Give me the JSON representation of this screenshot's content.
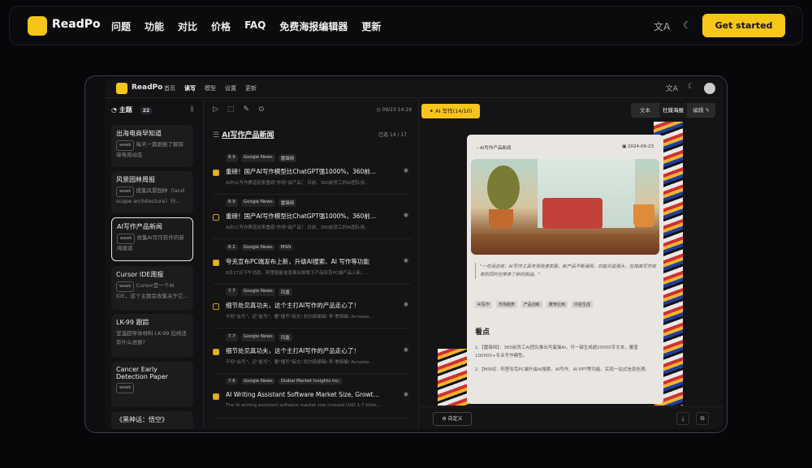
{
  "nav": {
    "brand": "ReadPo",
    "items": [
      "问题",
      "功能",
      "对比",
      "价格",
      "FAQ",
      "免费海报编辑器",
      "更新"
    ],
    "translate_icon": "文A",
    "theme_icon": "☾",
    "cta": "Get started"
  },
  "app": {
    "brand": "ReadPo",
    "nav": [
      "首页",
      "读写",
      "模型",
      "设置",
      "更新"
    ],
    "icons": [
      "文A",
      "☾"
    ],
    "sidebar": {
      "title": "主题",
      "count": "22",
      "topics": [
        {
          "title": "出海电商早知道",
          "badge": "week",
          "desc": "每天一篇跟报了解跨境电商动态"
        },
        {
          "title": "风景园林周报",
          "badge": "week",
          "desc": "搜集风景园林（land scape architecture）行..."
        },
        {
          "title": "AI写作产品新闻",
          "badge": "week",
          "desc": "收集AI写作软件的新闻报道"
        },
        {
          "title": "Cursor IDE周报",
          "badge": "week",
          "desc": "Cursor是一个AI IDE，这个主题会收集关于它..."
        },
        {
          "title": "LK-99 跟踪",
          "badge": "",
          "desc": "室温超导体材料 LK-99 后续还有什么进展?"
        },
        {
          "title": "Cancer Early Detection Paper",
          "badge": "week",
          "desc": ""
        },
        {
          "title": "《黑神话：悟空》",
          "badge": "",
          "desc": ""
        }
      ]
    },
    "middle": {
      "tools": [
        "▷",
        "⬚",
        "✎",
        "⊙"
      ],
      "time": "◷ 09/23 14:19",
      "title": "AI写作产品新闻",
      "selected": "已选 14 / 17",
      "list_icon": "☰",
      "items": [
        {
          "score": "8.9",
          "tags": [
            "Google News",
            "雷锋网"
          ],
          "title": "重磅！国产AI写作模型比ChatGPT强1000%，360前...",
          "summary": "AI办公写作赛道迎来重磅\"炸场\"级产品！ 日前，360前员工的AI团队用...",
          "checked": true
        },
        {
          "score": "8.9",
          "tags": [
            "Google News",
            "雷锋网"
          ],
          "title": "重磅！国产AI写作模型比ChatGPT强1000%，360前...",
          "summary": "AI办公写作赛道迎来重磅\"炸场\"级产品！ 日前，360前员工的AI团队用...",
          "checked": false
        },
        {
          "score": "8.2",
          "tags": [
            "Google News",
            "MSN"
          ],
          "title": "夸克宣布PC端发布上新，升级AI搜索、AI 写作等功能",
          "summary": "8月27日下午消息，阿里智能信息事业群旗下产品夸克PC端产品上新，...",
          "checked": true
        },
        {
          "score": "7.7",
          "tags": [
            "Google News",
            "凤凰"
          ],
          "title": "细节处见真功夫，这个主打AI写作的产品走心了！",
          "summary": "不但\"会写\"，还\"能写\"，要\"懂写\"搞文/ 凯尔颜编辑/ 李 季择编/ Annalee...",
          "checked": false
        },
        {
          "score": "7.7",
          "tags": [
            "Google News",
            "凤凰"
          ],
          "title": "细节处见真功夫，这个主打AI写作的产品走心了！",
          "summary": "不但\"会写\"，还\"能写\"，要\"懂写\"搞文/ 凯尔颜编辑/ 李 季择编/ Annalee...",
          "checked": true
        },
        {
          "score": "7.6",
          "tags": [
            "Google News",
            "Global Market Insights Inc."
          ],
          "title": "AI Writing Assistant Software Market Size, Growt...",
          "summary": "The AI writing assistant software market size crossed USD 1.7 billio...",
          "checked": true
        }
      ]
    },
    "right": {
      "ai_button": "✦ AI 写作(14/10)",
      "tabs": [
        "文本",
        "社媒海报",
        "编辑 ✎"
      ],
      "poster": {
        "back": "‹ AI写作产品新闻",
        "date": "▣ 2024-09-23",
        "quote": "\"一句话总结：AI写作工具市场快速发展，新产品不断涌现，功能日益强大，在提高写作效率的同时也带来了新的挑战。\"",
        "tags": [
          "AI写作",
          "市场趋势",
          "产品创新",
          "教育应用",
          "内容生成"
        ],
        "section": "看点",
        "points": [
          "1.【雷锋网】：360前员工AI团队推出写蛋猫AI，可一键生成超20000字文本，覆盖100000+专业写作模型。",
          "2.【MSN】：阿里夸克PC端升级AI搜索、AI写作、AI PPT等功能，实现一站式信息处理。"
        ]
      },
      "custom": "⚙ 自定义",
      "foot_icons": [
        "⤓",
        "⧉"
      ]
    }
  }
}
